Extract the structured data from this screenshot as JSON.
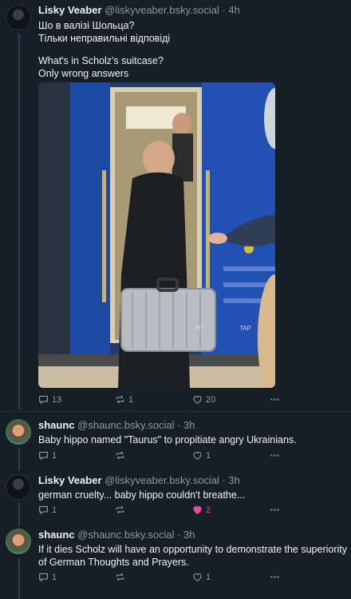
{
  "posts": [
    {
      "name": "Lisky Veaber",
      "handle": "@liskyveaber.bsky.social",
      "time": "· 4h",
      "lines": [
        "Шо в валізі Шольца?",
        "Тільки неправильні відповіді",
        "",
        "What's in Scholz's suitcase?",
        "Only wrong answers"
      ],
      "replies": "13",
      "reposts": "1",
      "likes": "20"
    },
    {
      "name": "shaunc",
      "handle": "@shaunc.bsky.social",
      "time": "· 3h",
      "lines": [
        "Baby hippo named \"Taurus\" to propitiate angry Ukrainians."
      ],
      "replies": "1",
      "reposts": "",
      "likes": "1"
    },
    {
      "name": "Lisky Veaber",
      "handle": "@liskyveaber.bsky.social",
      "time": "· 3h",
      "lines": [
        "german cruelty... baby hippo couldn't breathe..."
      ],
      "replies": "1",
      "reposts": "",
      "likes": "2"
    },
    {
      "name": "shaunc",
      "handle": "@shaunc.bsky.social",
      "time": "· 3h",
      "lines": [
        "If it dies Scholz will have an opportunity to demonstrate the superiority",
        "of German Thoughts and Prayers."
      ],
      "replies": "1",
      "reposts": "",
      "likes": "1"
    }
  ],
  "media": {
    "panel": "TAP",
    "panel2": "PIT"
  },
  "icons": {
    "reply": "reply-icon",
    "repost": "repost-icon",
    "like": "heart-icon",
    "more": "more-icon"
  },
  "colors": {
    "background": "#161e27",
    "liked": "#ec4899",
    "muted": "#8b98a5"
  }
}
